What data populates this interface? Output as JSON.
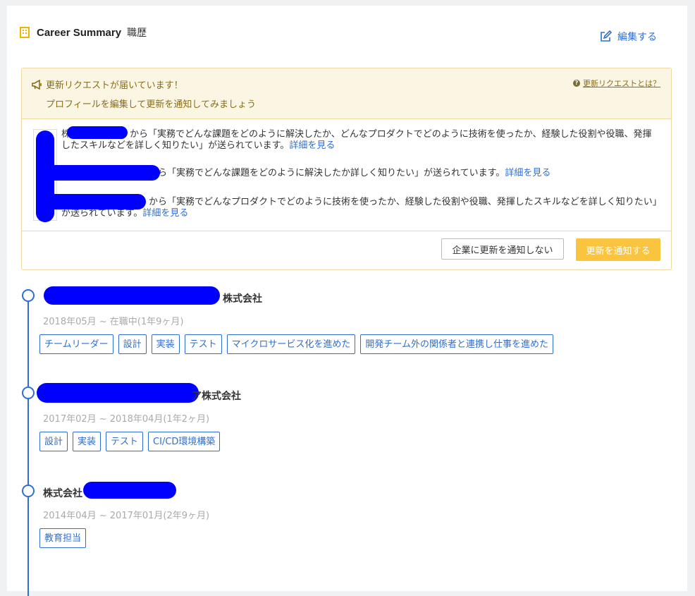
{
  "header": {
    "title_en": "Career Summary",
    "title_ja": "職歴",
    "edit_label": "編集する"
  },
  "notice": {
    "title": "更新リクエストが届いています！",
    "subtitle": "プロフィールを編集して更新を通知してみましょう",
    "what_link": "更新リクエストとは？",
    "requests": [
      {
        "prefix": "株",
        "text": "から「実務でどんな課題をどのように解決したか、どんなプロダクトでどのように技術を使ったか、経験した役割や役職、発揮したスキルなどを詳しく知りたい」が送られています。",
        "link": "詳細を見る"
      },
      {
        "prefix": "",
        "text": "から「実務でどんな課題をどのように解決したか詳しく知りたい」が送られています。",
        "link": "詳細を見る"
      },
      {
        "prefix": "",
        "text": "から「実務でどんなプロダクトでどのように技術を使ったか、経験した役割や役職、発揮したスキルなどを詳しく知りたい」が送られています。",
        "link": "詳細を見る"
      }
    ],
    "deny_label": "企業に更新を通知しない",
    "notify_label": "更新を通知する"
  },
  "careers": [
    {
      "company": "株式会社",
      "period": "2018年05月 ~ 在職中(1年9ヶ月)",
      "tags": [
        "チームリーダー",
        "設計",
        "実装",
        "テスト",
        "マイクロサービス化を進めた",
        "開発チーム外の関係者と連携し仕事を進めた"
      ]
    },
    {
      "company": "ア株式会社",
      "period": "2017年02月 ~ 2018年04月(1年2ヶ月)",
      "tags": [
        "設計",
        "実装",
        "テスト",
        "CI/CD環境構築"
      ]
    },
    {
      "company": "株式会社",
      "period": "2014年04月 ~ 2017年01月(2年9ヶ月)",
      "tags": [
        "教育担当"
      ]
    }
  ],
  "colors": {
    "accent": "#2f6fd1",
    "notice_bg": "#fbf6e4",
    "notify_button": "#fbc43f",
    "redaction": "#0000ff"
  },
  "icons": [
    "building-icon",
    "edit-icon",
    "megaphone-icon",
    "question-icon"
  ]
}
